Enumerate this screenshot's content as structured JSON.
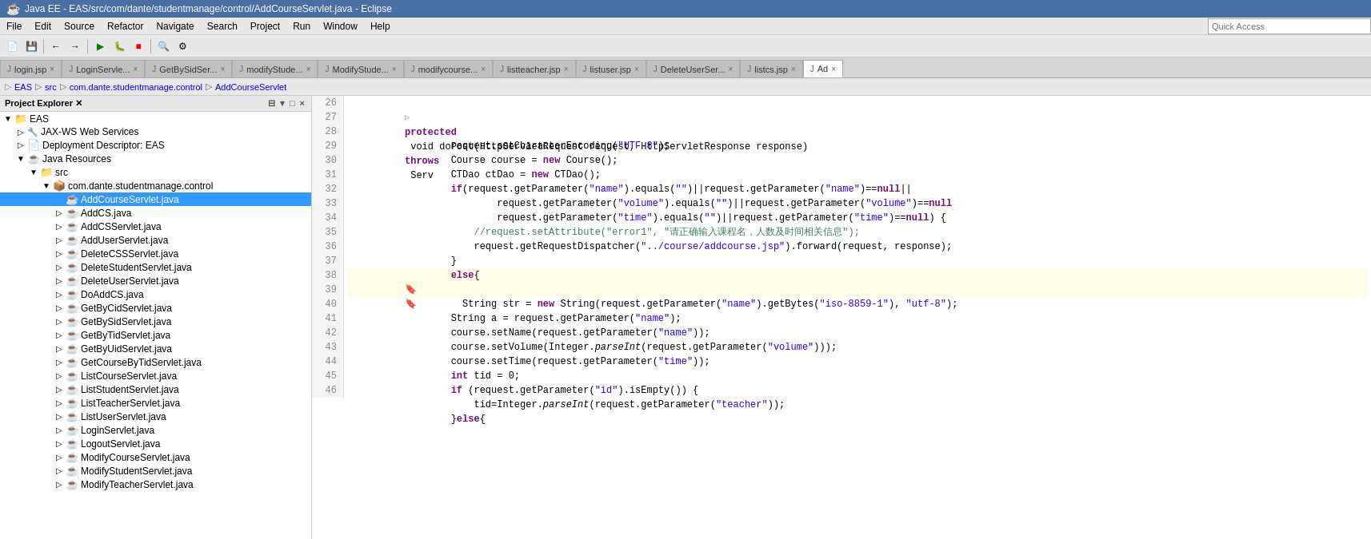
{
  "titleBar": {
    "title": "Java EE - EAS/src/com/dante/studentmanage/control/AddCourseServlet.java - Eclipse",
    "icon": "☕"
  },
  "menuBar": {
    "items": [
      "File",
      "Edit",
      "Source",
      "Refactor",
      "Navigate",
      "Search",
      "Project",
      "Run",
      "Window",
      "Help"
    ]
  },
  "quickAccess": {
    "placeholder": "Quick Access"
  },
  "tabs": [
    {
      "label": "login.jsp",
      "icon": "J",
      "active": false
    },
    {
      "label": "LoginServle...",
      "icon": "J",
      "active": false
    },
    {
      "label": "GetBySidSer...",
      "icon": "J",
      "active": false
    },
    {
      "label": "modifyStude...",
      "icon": "J",
      "active": false
    },
    {
      "label": "ModifyStude...",
      "icon": "J",
      "active": false
    },
    {
      "label": "modifycourse...",
      "icon": "J",
      "active": false
    },
    {
      "label": "listteacher.jsp",
      "icon": "J",
      "active": false
    },
    {
      "label": "listuser.jsp",
      "icon": "J",
      "active": false
    },
    {
      "label": "DeleteUserSer...",
      "icon": "J",
      "active": false
    },
    {
      "label": "listcs.jsp",
      "icon": "J",
      "active": false
    },
    {
      "label": "Ad",
      "icon": "J",
      "active": true
    }
  ],
  "breadcrumb": {
    "items": [
      "EAS",
      "src",
      "com.dante.studentmanage.control",
      "AddCourseServlet"
    ]
  },
  "sidebar": {
    "title": "Project Explorer",
    "tree": [
      {
        "level": 0,
        "label": "EAS",
        "icon": "📁",
        "toggle": "▼",
        "type": "project"
      },
      {
        "level": 1,
        "label": "JAX-WS Web Services",
        "icon": "🔧",
        "toggle": "▷",
        "type": "folder"
      },
      {
        "level": 1,
        "label": "Deployment Descriptor: EAS",
        "icon": "📄",
        "toggle": "▷",
        "type": "folder"
      },
      {
        "level": 1,
        "label": "Java Resources",
        "icon": "☕",
        "toggle": "▼",
        "type": "folder"
      },
      {
        "level": 2,
        "label": "src",
        "icon": "📁",
        "toggle": "▼",
        "type": "folder"
      },
      {
        "level": 3,
        "label": "com.dante.studentmanage.control",
        "icon": "📦",
        "toggle": "▼",
        "type": "package"
      },
      {
        "level": 4,
        "label": "AddCourseServlet.java",
        "icon": "☕",
        "toggle": "",
        "type": "file",
        "selected": true
      },
      {
        "level": 4,
        "label": "AddCS.java",
        "icon": "☕",
        "toggle": "▷",
        "type": "file"
      },
      {
        "level": 4,
        "label": "AddCSServlet.java",
        "icon": "☕",
        "toggle": "▷",
        "type": "file"
      },
      {
        "level": 4,
        "label": "AddUserServlet.java",
        "icon": "☕",
        "toggle": "▷",
        "type": "file"
      },
      {
        "level": 4,
        "label": "DeleteCSSServlet.java",
        "icon": "☕",
        "toggle": "▷",
        "type": "file"
      },
      {
        "level": 4,
        "label": "DeleteStudentServlet.java",
        "icon": "☕",
        "toggle": "▷",
        "type": "file"
      },
      {
        "level": 4,
        "label": "DeleteUserServlet.java",
        "icon": "☕",
        "toggle": "▷",
        "type": "file"
      },
      {
        "level": 4,
        "label": "DoAddCS.java",
        "icon": "☕",
        "toggle": "▷",
        "type": "file"
      },
      {
        "level": 4,
        "label": "GetByCidServlet.java",
        "icon": "☕",
        "toggle": "▷",
        "type": "file"
      },
      {
        "level": 4,
        "label": "GetBySidServlet.java",
        "icon": "☕",
        "toggle": "▷",
        "type": "file"
      },
      {
        "level": 4,
        "label": "GetByTidServlet.java",
        "icon": "☕",
        "toggle": "▷",
        "type": "file"
      },
      {
        "level": 4,
        "label": "GetByUidServlet.java",
        "icon": "☕",
        "toggle": "▷",
        "type": "file"
      },
      {
        "level": 4,
        "label": "GetCourseByTidServlet.java",
        "icon": "☕",
        "toggle": "▷",
        "type": "file"
      },
      {
        "level": 4,
        "label": "ListCourseServlet.java",
        "icon": "☕",
        "toggle": "▷",
        "type": "file"
      },
      {
        "level": 4,
        "label": "ListStudentServlet.java",
        "icon": "☕",
        "toggle": "▷",
        "type": "file"
      },
      {
        "level": 4,
        "label": "ListTeacherServlet.java",
        "icon": "☕",
        "toggle": "▷",
        "type": "file"
      },
      {
        "level": 4,
        "label": "ListUserServlet.java",
        "icon": "☕",
        "toggle": "▷",
        "type": "file"
      },
      {
        "level": 4,
        "label": "LoginServlet.java",
        "icon": "☕",
        "toggle": "▷",
        "type": "file"
      },
      {
        "level": 4,
        "label": "LogoutServlet.java",
        "icon": "☕",
        "toggle": "▷",
        "type": "file"
      },
      {
        "level": 4,
        "label": "ModifyCourseServlet.java",
        "icon": "☕",
        "toggle": "▷",
        "type": "file"
      },
      {
        "level": 4,
        "label": "ModifyStudentServlet.java",
        "icon": "☕",
        "toggle": "▷",
        "type": "file"
      },
      {
        "level": 4,
        "label": "ModifyTeacherServlet.java",
        "icon": "☕",
        "toggle": "▷",
        "type": "file"
      }
    ]
  },
  "codeLines": [
    {
      "num": 26,
      "indent": "    ",
      "content": "protected void doPost(HttpServletRequest request, HttpServletResponse response) throws Serv",
      "hasMarker": false,
      "markerType": ""
    },
    {
      "num": 27,
      "indent": "        ",
      "content": "request.setCharacterEncoding(\"UTF-8\");",
      "hasMarker": false
    },
    {
      "num": 28,
      "indent": "        ",
      "content": "Course course = new Course();",
      "hasMarker": false
    },
    {
      "num": 29,
      "indent": "        ",
      "content": "CTDao ctDao = new CTDao();",
      "hasMarker": false
    },
    {
      "num": 30,
      "indent": "        ",
      "content": "if(request.getParameter(\"name\").equals(\"\")||request.getParameter(\"name\")==null||",
      "hasMarker": false
    },
    {
      "num": 31,
      "indent": "                ",
      "content": "request.getParameter(\"volume\").equals(\"\")||request.getParameter(\"volume\")==null",
      "hasMarker": false
    },
    {
      "num": 32,
      "indent": "                ",
      "content": "request.getParameter(\"time\").equals(\"\")||request.getParameter(\"time\")==null) {",
      "hasMarker": false
    },
    {
      "num": 33,
      "indent": "            ",
      "content": "//request.setAttribute(\"error1\", \"请正确输入课程名，人数及时间相关信息\");",
      "hasMarker": false
    },
    {
      "num": 34,
      "indent": "            ",
      "content": "request.getRequestDispatcher(\"../course/addcourse.jsp\").forward(request, response);",
      "hasMarker": false
    },
    {
      "num": 35,
      "indent": "        ",
      "content": "}",
      "hasMarker": false
    },
    {
      "num": 36,
      "indent": "        ",
      "content": "else{",
      "hasMarker": false
    },
    {
      "num": 37,
      "indent": "        ",
      "content": "",
      "hasMarker": false
    },
    {
      "num": 38,
      "indent": "          ",
      "content": "String str = new String(request.getParameter(\"name\").getBytes(\"iso-8859-1\"), \"utf-8\");",
      "hasMarker": true,
      "markerType": "bookmark"
    },
    {
      "num": 39,
      "indent": "        ",
      "content": "String a = request.getParameter(\"name\");",
      "hasMarker": true,
      "markerType": "bookmark"
    },
    {
      "num": 40,
      "indent": "        ",
      "content": "course.setName(request.getParameter(\"name\"));",
      "hasMarker": false
    },
    {
      "num": 41,
      "indent": "        ",
      "content": "course.setVolume(Integer.parseInt(request.getParameter(\"volume\")));",
      "hasMarker": false
    },
    {
      "num": 42,
      "indent": "        ",
      "content": "course.setTime(request.getParameter(\"time\"));",
      "hasMarker": false
    },
    {
      "num": 43,
      "indent": "        ",
      "content": "int tid = 0;",
      "hasMarker": false
    },
    {
      "num": 44,
      "indent": "        ",
      "content": "if (request.getParameter(\"id\").isEmpty()) {",
      "hasMarker": false
    },
    {
      "num": 45,
      "indent": "            ",
      "content": "tid=Integer.parseInt(request.getParameter(\"teacher\"));",
      "hasMarker": false
    },
    {
      "num": 46,
      "indent": "        ",
      "content": "}else{",
      "hasMarker": false
    }
  ]
}
